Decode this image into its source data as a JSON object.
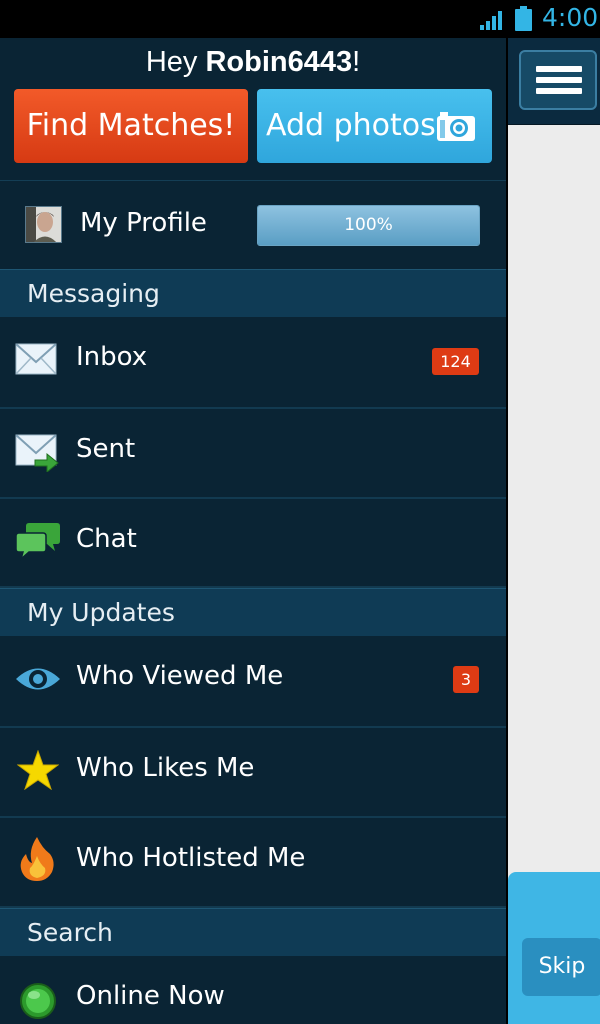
{
  "status_bar": {
    "time": "4:00"
  },
  "drawer": {
    "greeting_prefix": "Hey ",
    "username": "Robin6443",
    "greeting_suffix": "!",
    "find_matches_label": "Find Matches!",
    "add_photos_label": "Add photos",
    "profile": {
      "label": "My Profile",
      "completion_percent": 100,
      "completion_text": "100%"
    },
    "sections": [
      {
        "title": "Messaging",
        "items": [
          {
            "label": "Inbox",
            "icon": "envelope-icon",
            "badge": "124"
          },
          {
            "label": "Sent",
            "icon": "sent-envelope-icon"
          },
          {
            "label": "Chat",
            "icon": "chat-bubbles-icon"
          }
        ]
      },
      {
        "title": "My Updates",
        "items": [
          {
            "label": "Who Viewed Me",
            "icon": "eye-icon",
            "badge": "3"
          },
          {
            "label": "Who Likes Me",
            "icon": "star-icon"
          },
          {
            "label": "Who Hotlisted Me",
            "icon": "flame-icon"
          }
        ]
      },
      {
        "title": "Search",
        "items": [
          {
            "label": "Online Now",
            "icon": "online-dot-icon"
          }
        ]
      }
    ]
  },
  "content": {
    "skip_label": "Skip"
  },
  "colors": {
    "drawer_background": "#0a2434",
    "section_header_background": "#0f3b55",
    "find_matches": "#e84a1e",
    "add_photos": "#3fb6e5",
    "badge": "#de3b14",
    "status_accent": "#33b5e5"
  }
}
